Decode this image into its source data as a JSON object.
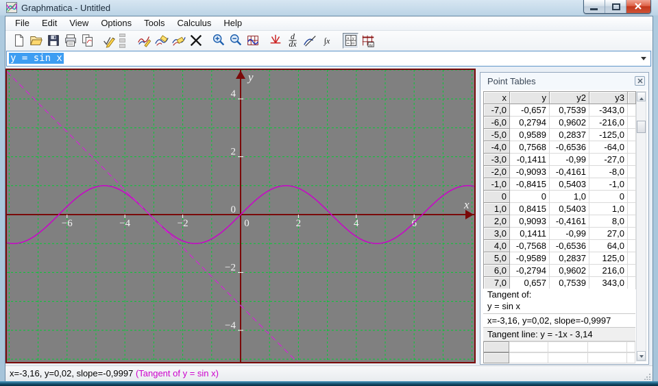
{
  "window": {
    "title": "Graphmatica - Untitled"
  },
  "menubar": {
    "items": [
      "File",
      "Edit",
      "View",
      "Options",
      "Tools",
      "Calculus",
      "Help"
    ]
  },
  "toolbar": {
    "icons": [
      "new",
      "open",
      "save",
      "print",
      "copy",
      "check-equations",
      "grip",
      "draw-graph",
      "erase-graph",
      "redraw-graph",
      "clear-screen",
      "zoom-in",
      "zoom-out",
      "grid-range",
      "critical-points",
      "derivative",
      "draw-tangent",
      "integrate",
      "point-tables",
      "plot-points"
    ],
    "pressed": "point-tables",
    "glyphs": {
      "d": "d",
      "dx": "dx",
      "integral": "∫x",
      "xy": "xy",
      "cellx": "x",
      "celly": "y"
    }
  },
  "equation": {
    "value": "y = sin x",
    "selected": true
  },
  "chart_data": {
    "type": "line",
    "functions": [
      {
        "label": "y = sin x",
        "expr": "sin(x)",
        "style": "solid"
      },
      {
        "label": "Tangent line: y = -1x - 3,14",
        "expr": "-1*x - 3.14",
        "style": "dashed",
        "slope": -1,
        "intercept": -3.14
      }
    ],
    "x_range": [
      -8.1,
      8.1
    ],
    "y_range": [
      -5.1,
      5.0
    ],
    "x_ticks": [
      -6,
      -4,
      -2,
      0,
      2,
      4,
      6
    ],
    "y_ticks": [
      -4,
      -2,
      0,
      2,
      4
    ],
    "grid_step": 1,
    "xlabel": "x",
    "ylabel": "y",
    "legend": "off",
    "tangent_point": {
      "x": -3.16,
      "y": 0.02,
      "slope": -0.9997
    },
    "colors": {
      "curve": "#cc00cc",
      "tangent": "#cc2fcc",
      "grid": "#00cc33",
      "axis": "#7a0909",
      "bg": "#808080",
      "label": "#f4f4f4"
    }
  },
  "panel": {
    "title": "Point Tables",
    "table": {
      "columns": [
        "x",
        "y",
        "y2",
        "y3"
      ],
      "rows": [
        [
          "-7,0",
          "-0,657",
          "0,7539",
          "-343,0"
        ],
        [
          "-6,0",
          "0,2794",
          "0,9602",
          "-216,0"
        ],
        [
          "-5,0",
          "0,9589",
          "0,2837",
          "-125,0"
        ],
        [
          "-4,0",
          "0,7568",
          "-0,6536",
          "-64,0"
        ],
        [
          "-3,0",
          "-0,1411",
          "-0,99",
          "-27,0"
        ],
        [
          "-2,0",
          "-0,9093",
          "-0,4161",
          "-8,0"
        ],
        [
          "-1,0",
          "-0,8415",
          "0,5403",
          "-1,0"
        ],
        [
          "0",
          "0",
          "1,0",
          "0"
        ],
        [
          "1,0",
          "0,8415",
          "0,5403",
          "1,0"
        ],
        [
          "2,0",
          "0,9093",
          "-0,4161",
          "8,0"
        ],
        [
          "3,0",
          "0,1411",
          "-0,99",
          "27,0"
        ],
        [
          "4,0",
          "-0,7568",
          "-0,6536",
          "64,0"
        ],
        [
          "5,0",
          "-0,9589",
          "0,2837",
          "125,0"
        ],
        [
          "6,0",
          "-0,2794",
          "0,9602",
          "216,0"
        ],
        [
          "7,0",
          "0,657",
          "0,7539",
          "343,0"
        ]
      ]
    },
    "info": {
      "tangent_of_label": "Tangent of:",
      "tangent_of_eq": "y = sin x",
      "readout": "x=-3,16, y=0,02, slope=-0,9997",
      "tangent_line": "Tangent line: y = -1x - 3,14"
    }
  },
  "status": {
    "position": "x=-3,16, y=0,02, slope=-0,9997 ",
    "note": "(Tangent of y = sin x)"
  }
}
